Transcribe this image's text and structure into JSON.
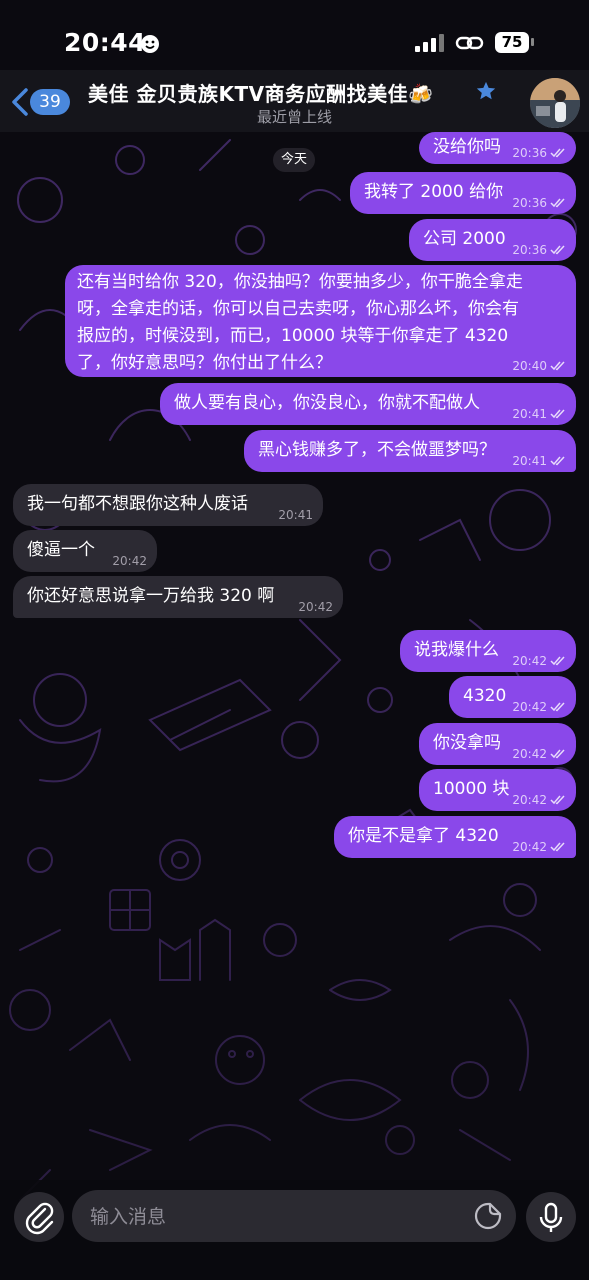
{
  "status": {
    "time": "20:44",
    "battery": "75"
  },
  "header": {
    "unread_count": "39",
    "title": "美佳 金贝贵族KTV商务应酬找美佳🍻",
    "subtitle": "最近曾上线"
  },
  "date_chip": "今天",
  "messages": [
    {
      "dir": "out",
      "text": "没给你吗",
      "time": "20:36"
    },
    {
      "dir": "out",
      "text": "我转了 2000 给你",
      "time": "20:36"
    },
    {
      "dir": "out",
      "text": "公司 2000",
      "time": "20:36"
    },
    {
      "dir": "out",
      "text": "还有当时给你 320，你没抽吗？你要抽多少，你干脆全拿走\n呀，全拿走的话，你可以自己去卖呀，你心那么坏，你会有\n报应的，时候没到，而已，10000 块等于你拿走了 4320\n了，你好意思吗？你付出了什么？",
      "time": "20:40"
    },
    {
      "dir": "out",
      "text": "做人要有良心，你没良心，你就不配做人",
      "time": "20:41"
    },
    {
      "dir": "out",
      "text": "黑心钱赚多了，不会做噩梦吗？",
      "time": "20:41"
    },
    {
      "dir": "in",
      "text": "我一句都不想跟你这种人废话",
      "time": "20:41"
    },
    {
      "dir": "in",
      "text": "傻逼一个",
      "time": "20:42"
    },
    {
      "dir": "in",
      "text": "你还好意思说拿一万给我 320 啊",
      "time": "20:42"
    },
    {
      "dir": "out",
      "text": "说我爆什么",
      "time": "20:42"
    },
    {
      "dir": "out",
      "text": "4320",
      "time": "20:42"
    },
    {
      "dir": "out",
      "text": "你没拿吗",
      "time": "20:42"
    },
    {
      "dir": "out",
      "text": "10000 块",
      "time": "20:42"
    },
    {
      "dir": "out",
      "text": "你是不是拿了 4320",
      "time": "20:42"
    }
  ],
  "input": {
    "placeholder": "输入消息"
  },
  "colors": {
    "outgoing": "#8a48ea",
    "incoming": "#2c2a33",
    "accent": "#4a88dc"
  },
  "icons": [
    "back-chevron-icon",
    "star-icon",
    "paperclip-icon",
    "sticker-icon",
    "microphone-icon",
    "read-check-icon"
  ]
}
